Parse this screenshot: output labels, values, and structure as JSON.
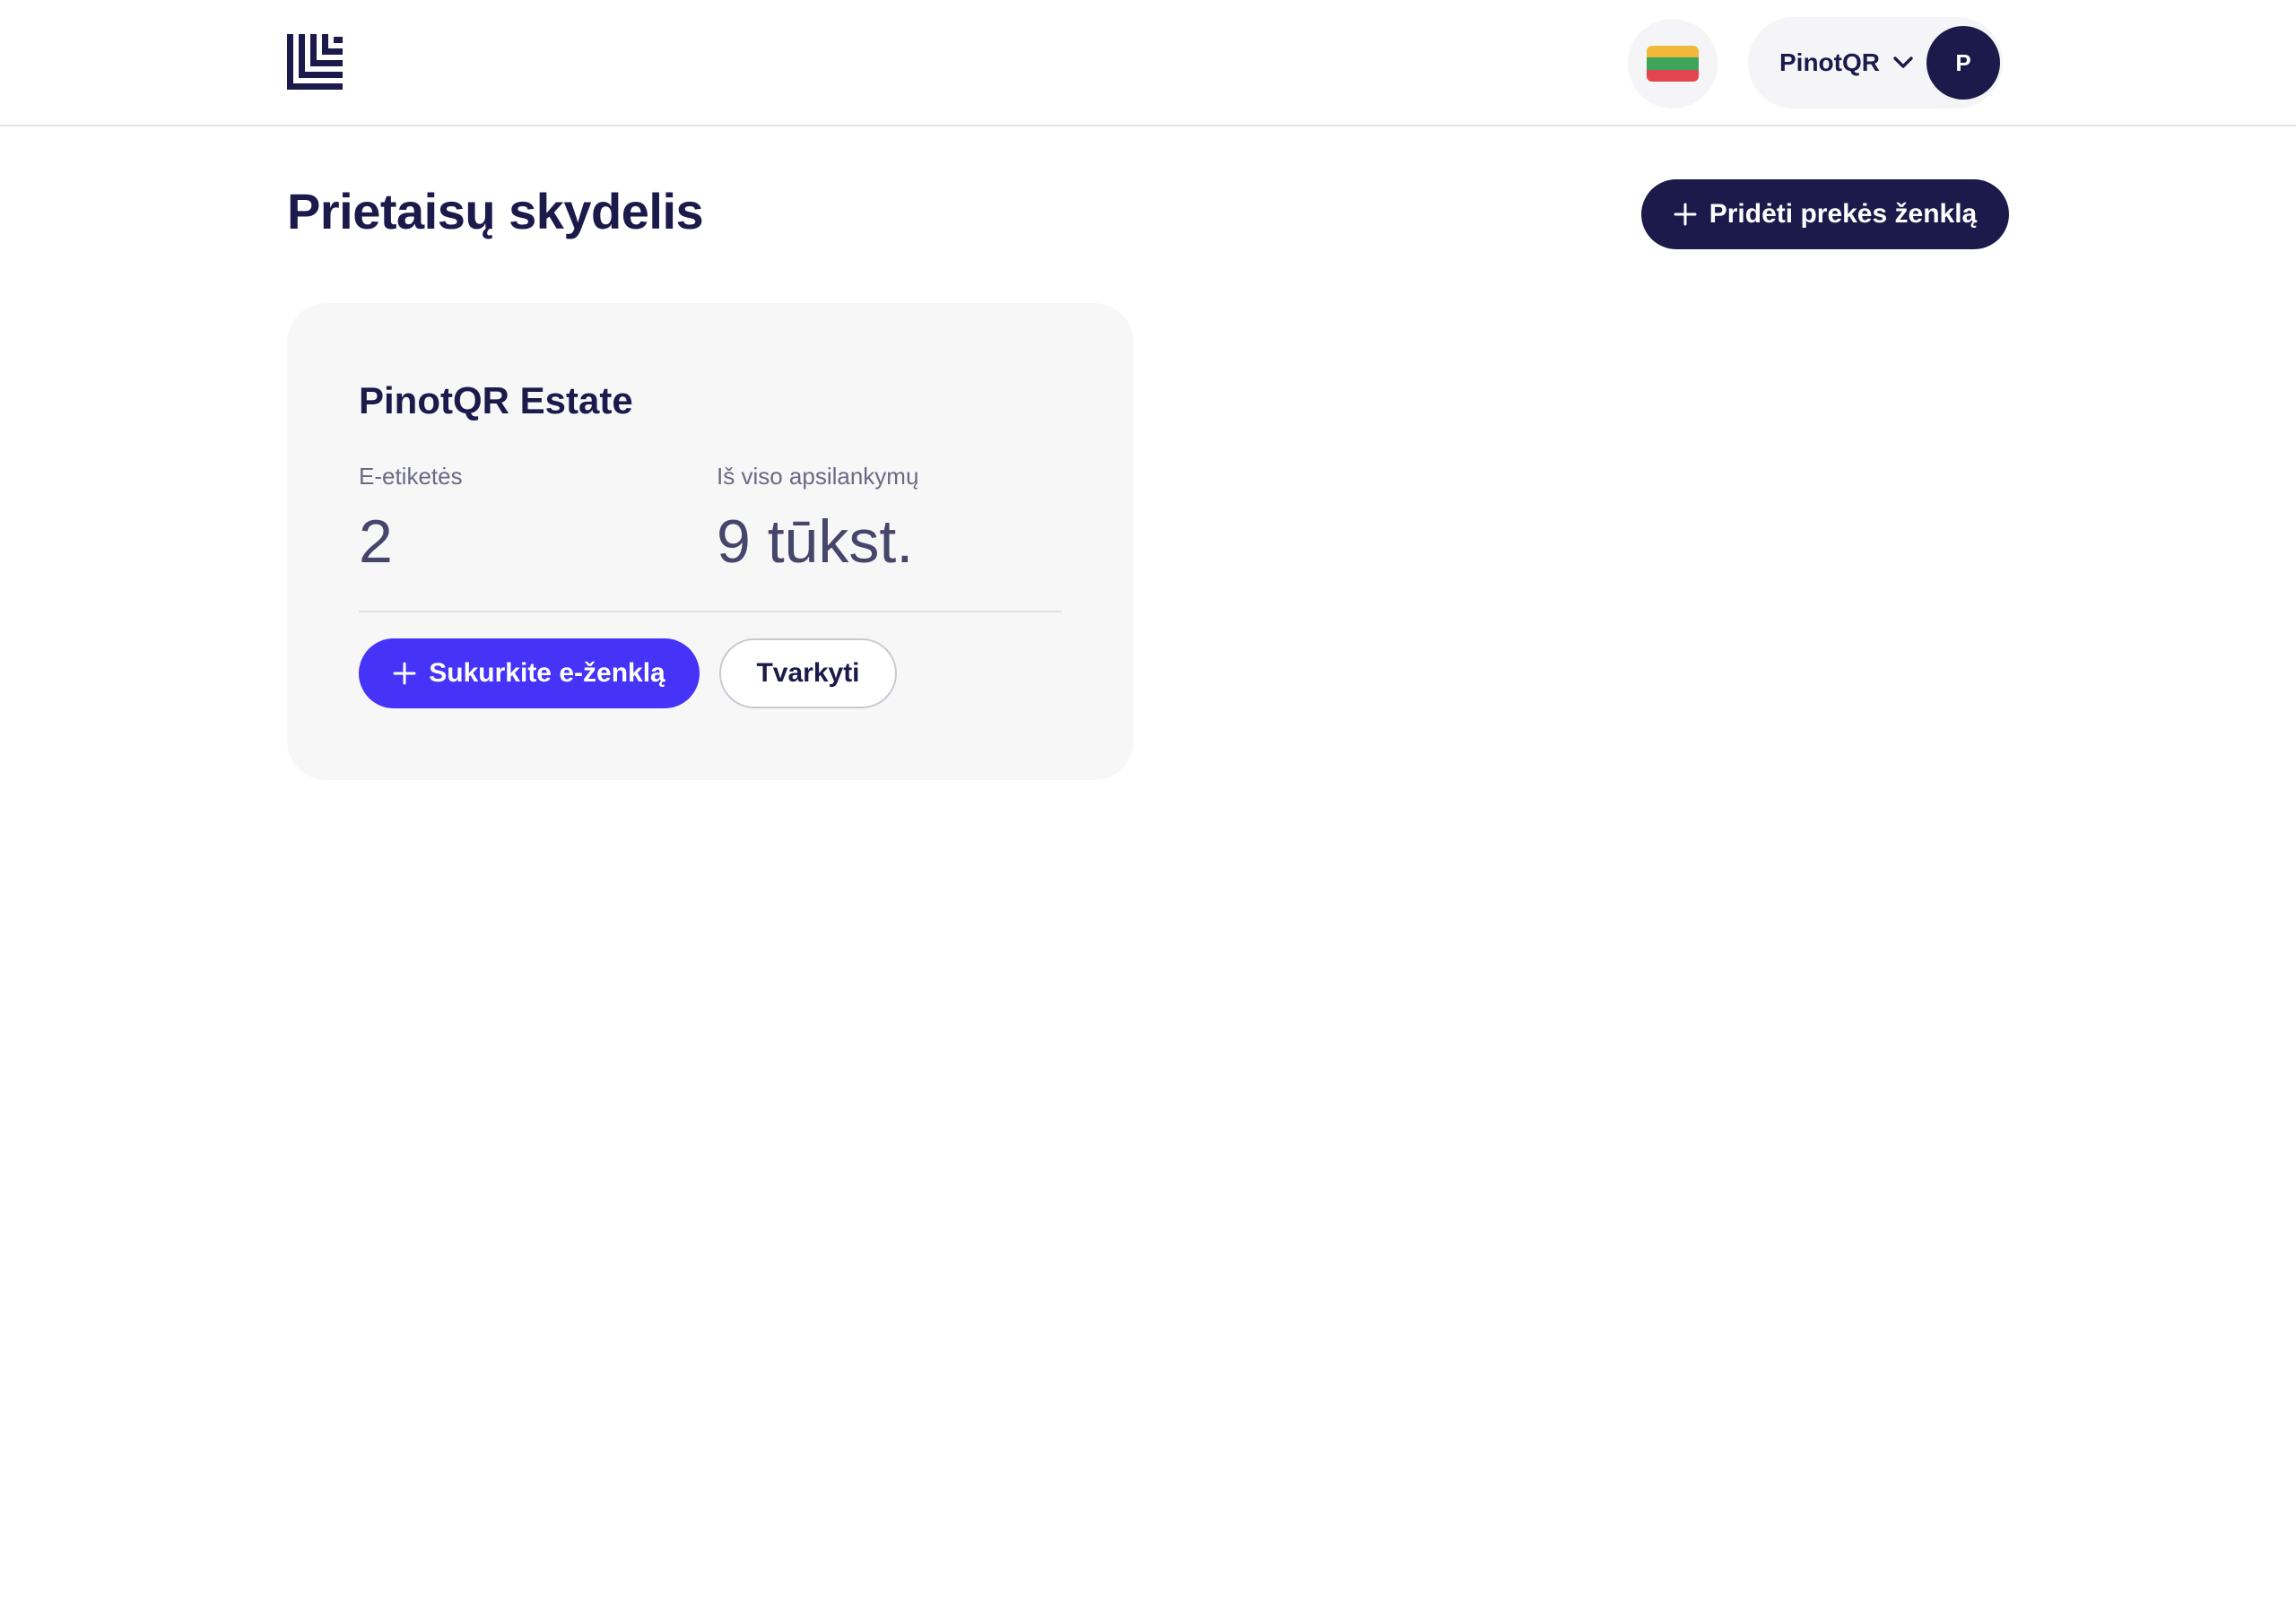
{
  "header": {
    "logo_icon": "brand-logo-icon",
    "language_icon": "lithuania-flag-icon",
    "flag_colors": [
      "#f2b83a",
      "#3ea55a",
      "#e2454d"
    ],
    "account": {
      "name": "PinotQR",
      "avatar_initial": "P",
      "chevron_icon": "chevron-down-icon"
    }
  },
  "page": {
    "title": "Prietaisų skydelis",
    "add_brand_label": "Pridėti prekės ženklą"
  },
  "brand_card": {
    "name": "PinotQR Estate",
    "stats": [
      {
        "label": "E-etiketės",
        "value": "2"
      },
      {
        "label": "Iš viso apsilankymų",
        "value": "9 tūkst."
      }
    ],
    "create_label": "Sukurkite e-ženklą",
    "manage_label": "Tvarkyti"
  },
  "colors": {
    "navy": "#1b1a4b",
    "accent": "#4534f7",
    "card_bg": "#f7f7f8"
  }
}
